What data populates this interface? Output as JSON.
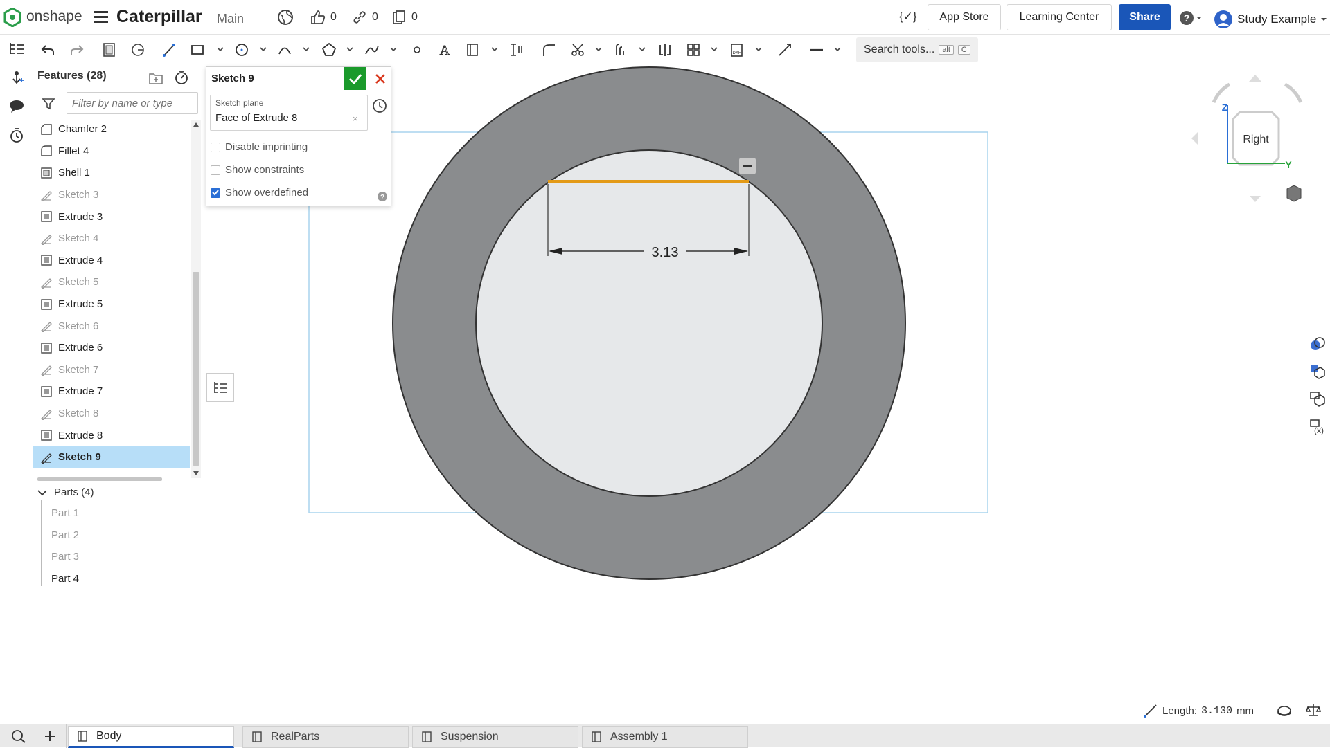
{
  "app": {
    "logo_text": "onshape",
    "doc_title": "Caterpillar",
    "branch": "Main",
    "likes": "0",
    "links": "0",
    "copies": "0"
  },
  "topbar": {
    "app_store": "App Store",
    "learning_center": "Learning Center",
    "share": "Share",
    "user": "Study Example"
  },
  "toolbar": {
    "search_placeholder": "Search tools...",
    "search_kbd_1": "alt",
    "search_kbd_2": "C"
  },
  "features": {
    "header": "Features (28)",
    "filter_placeholder": "Filter by name or type",
    "items": [
      {
        "label": "Chamfer 2",
        "icon": "chamfer-icon"
      },
      {
        "label": "Fillet 4",
        "icon": "fillet-icon"
      },
      {
        "label": "Shell 1",
        "icon": "shell-icon"
      },
      {
        "label": "Sketch 3",
        "icon": "sketch-icon"
      },
      {
        "label": "Extrude 3",
        "icon": "extrude-icon"
      },
      {
        "label": "Sketch 4",
        "icon": "sketch-icon"
      },
      {
        "label": "Extrude 4",
        "icon": "extrude-icon"
      },
      {
        "label": "Sketch 5",
        "icon": "sketch-icon"
      },
      {
        "label": "Extrude 5",
        "icon": "extrude-icon"
      },
      {
        "label": "Sketch 6",
        "icon": "sketch-icon"
      },
      {
        "label": "Extrude 6",
        "icon": "extrude-icon"
      },
      {
        "label": "Sketch 7",
        "icon": "sketch-icon"
      },
      {
        "label": "Extrude 7",
        "icon": "extrude-icon"
      },
      {
        "label": "Sketch 8",
        "icon": "sketch-icon"
      },
      {
        "label": "Extrude 8",
        "icon": "extrude-icon"
      },
      {
        "label": "Sketch 9",
        "icon": "sketch-icon"
      }
    ],
    "parts_header": "Parts (4)",
    "parts": [
      "Part 1",
      "Part 2",
      "Part 3",
      "Part 4"
    ]
  },
  "sketch_dialog": {
    "title": "Sketch 9",
    "plane_label": "Sketch plane",
    "plane_value": "Face of Extrude 8",
    "opt_imprinting": "Disable imprinting",
    "opt_constraints": "Show constraints",
    "opt_overdefined": "Show overdefined",
    "imprinting_checked": false,
    "constraints_checked": false,
    "overdefined_checked": true
  },
  "viewport": {
    "dimension_value": "3.13",
    "view_cube_label": "Right",
    "axis_z": "Z",
    "axis_y": "Y",
    "sketch_line_color": "#e39a17",
    "part_color": "#8a8c8e",
    "face_color": "#e6e8ea"
  },
  "status": {
    "length_label": "Length:",
    "length_value": "3.130",
    "length_unit": "mm"
  },
  "tabs": [
    "Body",
    "RealParts",
    "Suspension",
    "Assembly 1"
  ],
  "colors": {
    "accent": "#1a56b8",
    "ok_green": "#1a9a2b",
    "cancel_red": "#d9381e",
    "selected_row": "#b7def8"
  }
}
